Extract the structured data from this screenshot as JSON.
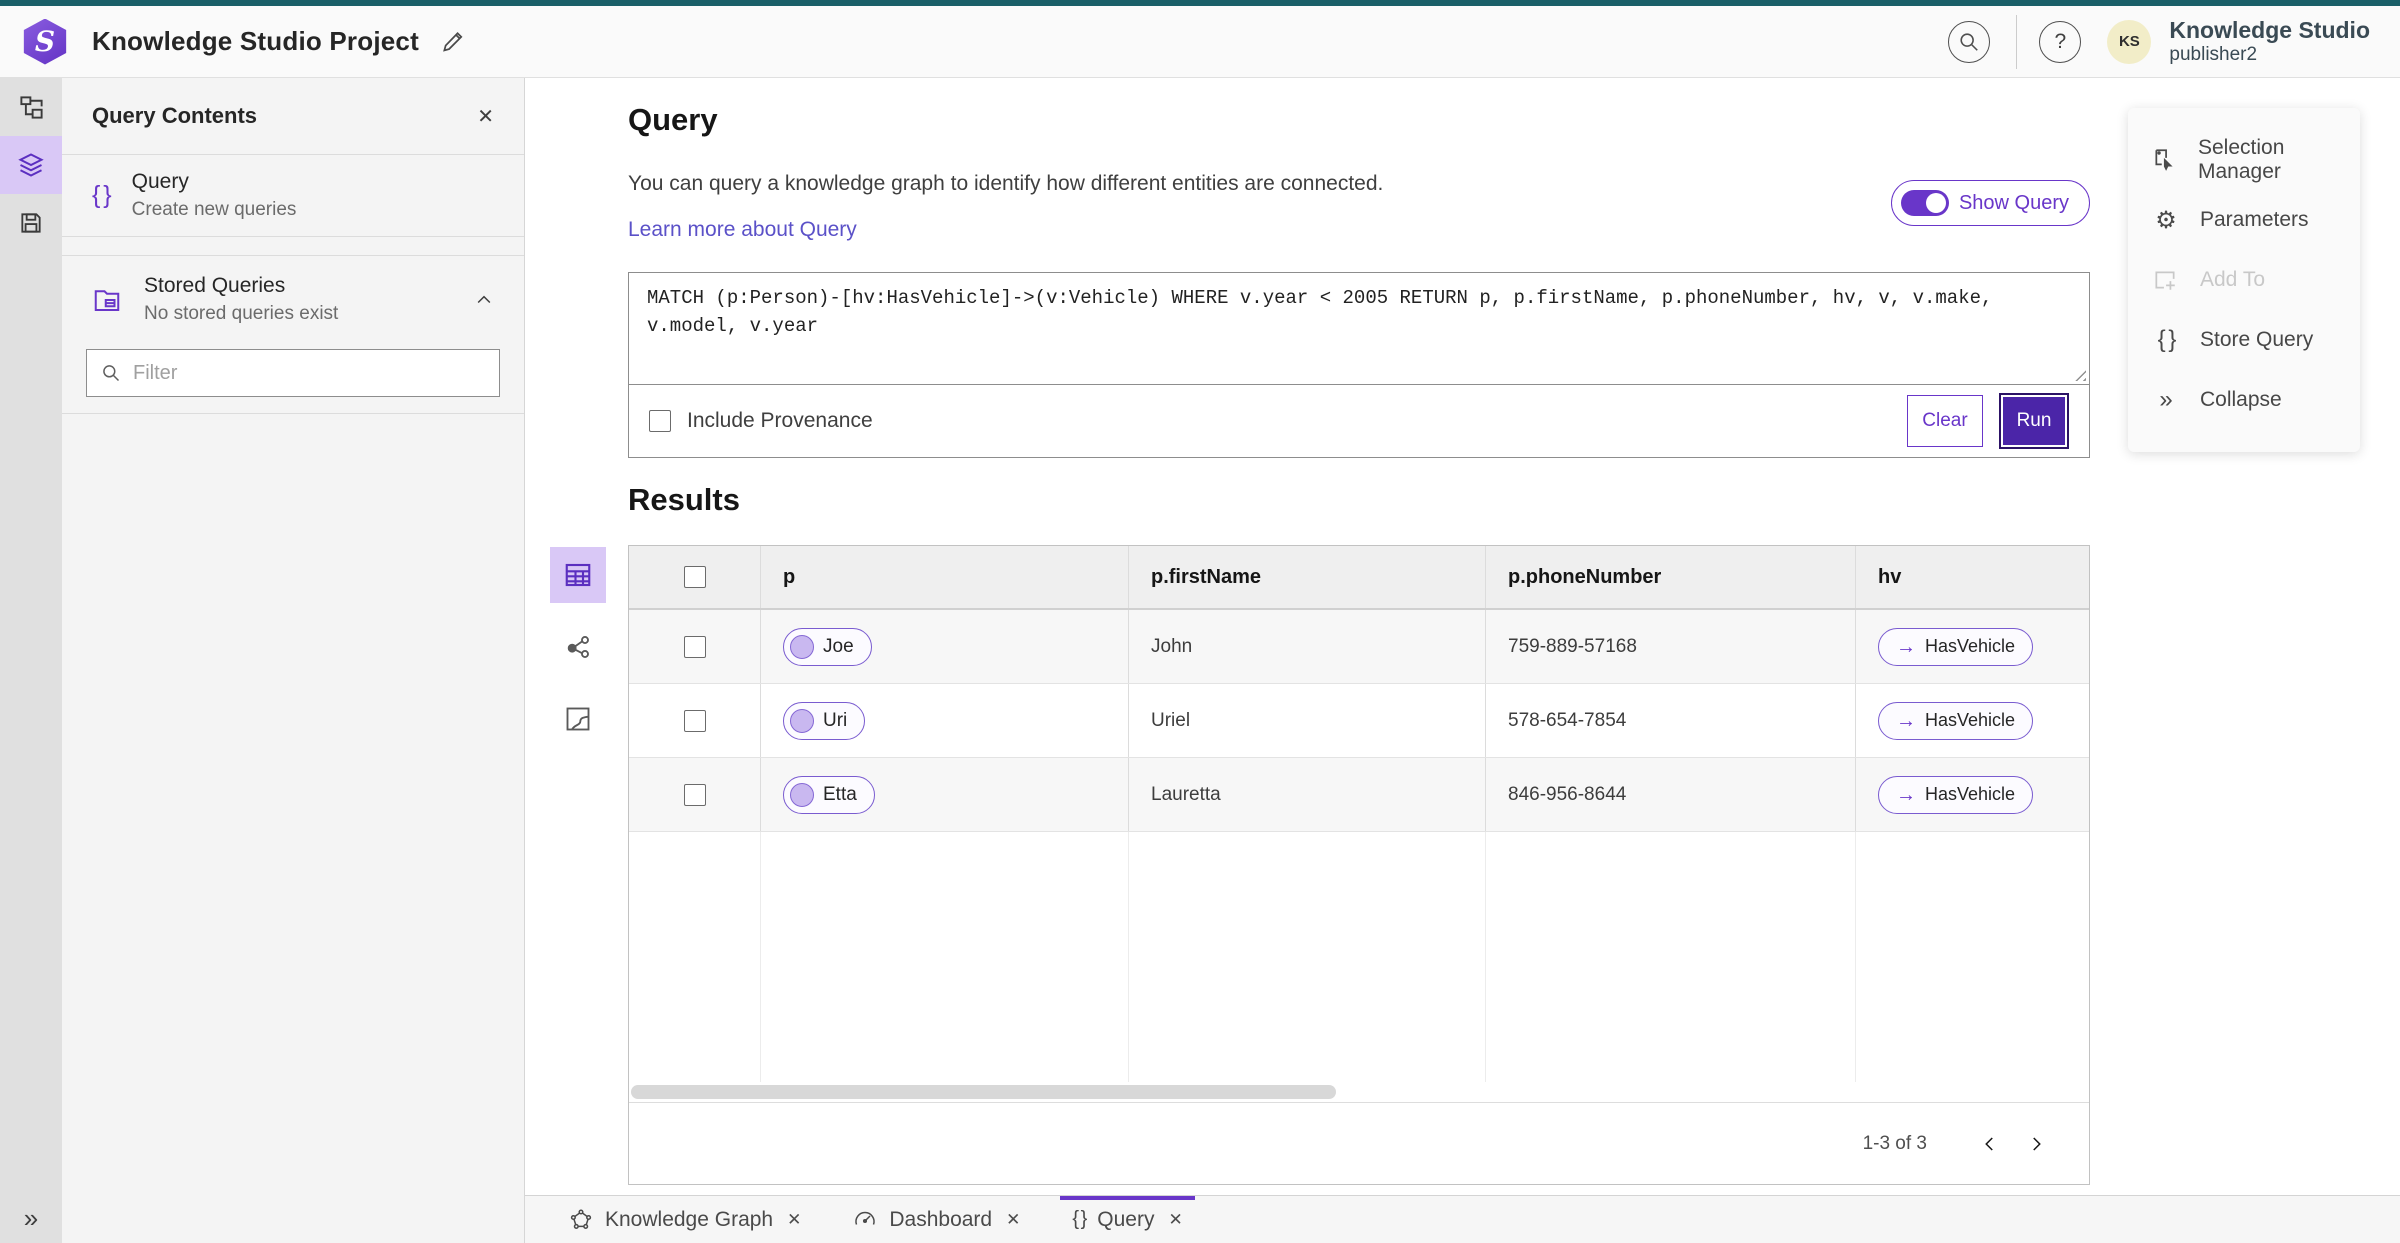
{
  "header": {
    "title": "Knowledge Studio Project",
    "user": {
      "name": "Knowledge Studio",
      "role": "publisher2",
      "initials": "KS"
    },
    "logo_letter": "S"
  },
  "panel": {
    "title": "Query Contents",
    "query_item": {
      "title": "Query",
      "subtitle": "Create new queries"
    },
    "stored_queries": {
      "title": "Stored Queries",
      "subtitle": "No stored queries exist"
    },
    "filter_placeholder": "Filter"
  },
  "query_section": {
    "title": "Query",
    "description": "You can query a knowledge graph to identify how different entities are connected.",
    "learn_more": "Learn more about Query",
    "show_query_label": "Show Query",
    "query_text": "MATCH (p:Person)-[hv:HasVehicle]->(v:Vehicle) WHERE v.year < 2005 RETURN p, p.firstName, p.phoneNumber, hv, v, v.make, v.model, v.year",
    "include_provenance_label": "Include Provenance",
    "clear_label": "Clear",
    "run_label": "Run"
  },
  "results": {
    "title": "Results",
    "columns": [
      "p",
      "p.firstName",
      "p.phoneNumber",
      "hv"
    ],
    "rows": [
      {
        "p": "Joe",
        "firstName": "John",
        "phoneNumber": "759-889-57168",
        "hv": "HasVehicle"
      },
      {
        "p": "Uri",
        "firstName": "Uriel",
        "phoneNumber": "578-654-7854",
        "hv": "HasVehicle"
      },
      {
        "p": "Etta",
        "firstName": "Lauretta",
        "phoneNumber": "846-956-8644",
        "hv": "HasVehicle"
      }
    ],
    "pagination": "1-3 of 3"
  },
  "right_menu": {
    "selection_manager": "Selection Manager",
    "parameters": "Parameters",
    "add_to": "Add To",
    "store_query": "Store Query",
    "collapse": "Collapse"
  },
  "tabs": [
    {
      "label": "Knowledge Graph"
    },
    {
      "label": "Dashboard"
    },
    {
      "label": "Query"
    }
  ],
  "icons": {
    "close": "✕",
    "braces": "{ }",
    "collapse": "»",
    "arrow_right": "→",
    "gear": "⚙",
    "help": "?"
  },
  "colors": {
    "accent_purple": "#6936c9",
    "run_button": "#4b25a8",
    "selected_highlight": "#d9c8f6",
    "top_strip_teal": "#1a5f68",
    "link": "#5b51c8"
  }
}
